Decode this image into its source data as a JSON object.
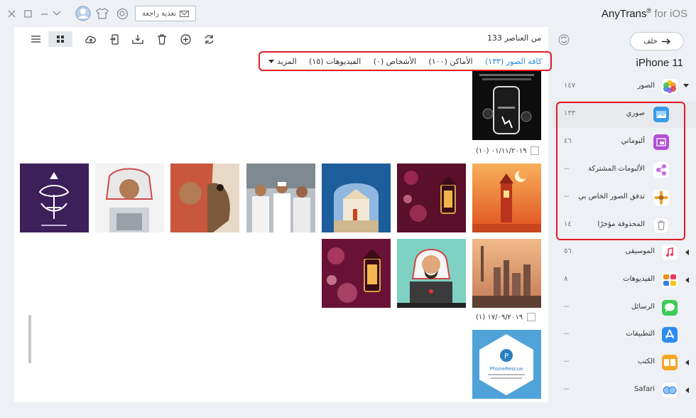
{
  "titlebar": {
    "feedback_label": "تغذية راجعة",
    "app_name": "AnyTrans",
    "app_reg": "®",
    "app_suffix": "for iOS",
    "icons": [
      "close-icon",
      "maximize-icon",
      "minimize-icon",
      "chevron-down-icon",
      "account-icon",
      "skin-icon",
      "search-icon",
      "envelope-icon"
    ]
  },
  "toolbar": {
    "item_count": "133 من العناصر",
    "tools": [
      "list-view-icon",
      "grid-view-icon",
      "upload-icon",
      "to-device-icon",
      "to-computer-icon",
      "delete-icon",
      "add-icon",
      "refresh-icon"
    ]
  },
  "filters": [
    {
      "label": "كافة الصور (١٣٣)",
      "active": true
    },
    {
      "label": "الأماكن (١٠٠)"
    },
    {
      "label": "الأشخاص (٠)"
    },
    {
      "label": "الفيديوهات (١٥)"
    },
    {
      "label": "المزيد"
    }
  ],
  "photos": {
    "groups": [
      {
        "date": "٠١/١١/٢٠١٩ (١٠)"
      },
      {
        "date": "١٧/٠٩/٢٠١٩ (١)"
      }
    ],
    "items": [
      {
        "name": "phone-promo-photo",
        "subject": "PhoneRescue phone promo"
      },
      {
        "name": "lantern-moon-photo",
        "subject": "orange lantern with crescent moon"
      },
      {
        "name": "lantern-bokeh-photo",
        "subject": "lantern with bokeh lights"
      },
      {
        "name": "mosque-gate-photo",
        "subject": "mosque gate"
      },
      {
        "name": "crowd-photo",
        "subject": "men in traditional dress"
      },
      {
        "name": "falcon-photo",
        "subject": "man with falcon"
      },
      {
        "name": "laptop-man-photo",
        "subject": "man with laptop"
      },
      {
        "name": "calligraphy-photo",
        "subject": "purple calligraphy"
      },
      {
        "name": "city-skyline-photo",
        "subject": "city skyline at sunset"
      },
      {
        "name": "gamer-illustration-photo",
        "subject": "man with laptop illustration"
      },
      {
        "name": "lantern-night-photo",
        "subject": "lantern at night"
      },
      {
        "name": "phonerescue-logo-photo",
        "subject": "PhoneRescue logo",
        "text": "PhoneRescue"
      }
    ]
  },
  "sidebar": {
    "back_label": "خلف",
    "device_name": "iPhone 11",
    "categories": [
      {
        "label": "الصور",
        "count": "١٤٧",
        "icon": "photos-icon",
        "expanded": true
      },
      {
        "label": "صوري",
        "count": "١٣٣",
        "icon": "my-photos-icon",
        "sub": true,
        "selected": true
      },
      {
        "label": "ألبوماتي",
        "count": "٤٦",
        "icon": "albums-icon",
        "sub": true
      },
      {
        "label": "الألبومات المشتركة",
        "count": "--",
        "icon": "shared-albums-icon",
        "sub": true
      },
      {
        "label": "تدفق الصور الخاص بي",
        "count": "--",
        "icon": "photo-stream-icon",
        "sub": true
      },
      {
        "label": "المحذوفة مؤخرًا",
        "count": "١٤",
        "icon": "trash-icon",
        "sub": true
      },
      {
        "label": "الموسيقى",
        "count": "٥٦",
        "icon": "music-icon"
      },
      {
        "label": "الفيديوهات",
        "count": "٨",
        "icon": "videos-icon"
      },
      {
        "label": "الرسائل",
        "count": "--",
        "icon": "messages-icon"
      },
      {
        "label": "التطبيقات",
        "count": "--",
        "icon": "apps-icon"
      },
      {
        "label": "الكتب",
        "count": "--",
        "icon": "books-icon"
      },
      {
        "label": "Safari",
        "count": "--",
        "icon": "safari-icon"
      }
    ]
  },
  "colors": {
    "accent": "#2b8bd6",
    "highlight": "#e21b23"
  }
}
